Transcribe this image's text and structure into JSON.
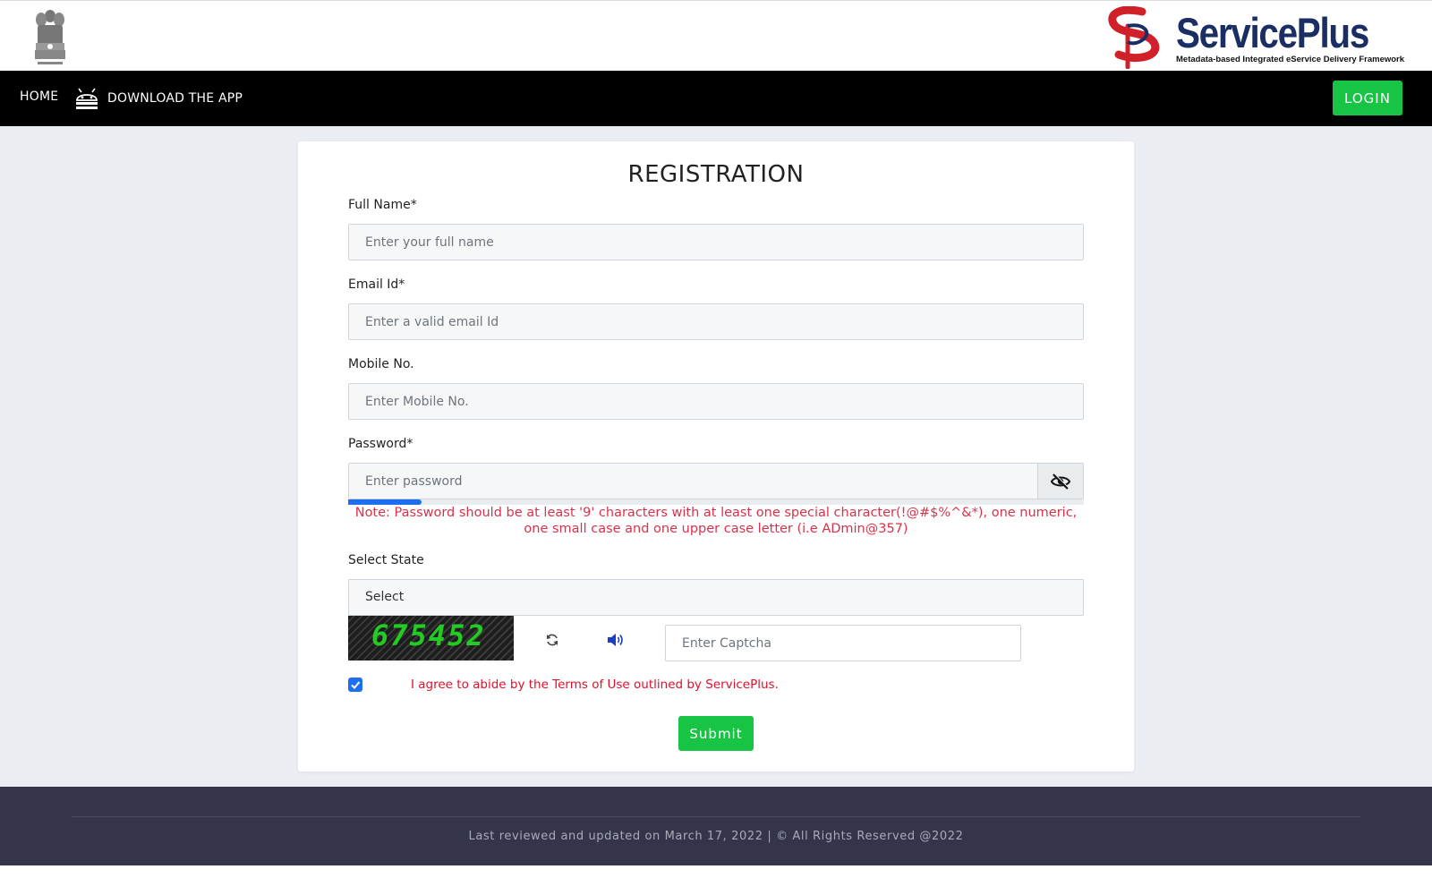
{
  "header": {
    "brand_name": "ServicePlus",
    "brand_tagline": "Metadata-based Integrated eService Delivery Framework"
  },
  "nav": {
    "home": "HOME",
    "download_app": "DOWNLOAD THE APP",
    "login": "LOGIN"
  },
  "form": {
    "title": "REGISTRATION",
    "full_name": {
      "label": "Full Name*",
      "placeholder": "Enter your full name",
      "value": ""
    },
    "email": {
      "label": "Email Id*",
      "placeholder": "Enter a valid email Id",
      "value": ""
    },
    "mobile": {
      "label": "Mobile No.",
      "placeholder": "Enter Mobile No.",
      "value": ""
    },
    "password": {
      "label": "Password*",
      "placeholder": "Enter password",
      "value": "",
      "strength": 0.1,
      "note": "Note: Password should be at least '9' characters with at least one special character(!@#$%^&*), one numeric, one small case and one upper case letter (i.e ADmin@357)"
    },
    "state": {
      "label": "Select State",
      "selected": "Select"
    },
    "captcha": {
      "code": "675452",
      "placeholder": "Enter Captcha",
      "value": ""
    },
    "agree": {
      "checked": true,
      "text": "I agree to abide by the Terms of Use outlined by ServicePlus."
    },
    "submit": "Submit"
  },
  "footer": {
    "text": "Last reviewed and updated on March 17, 2022 | © All Rights Reserved @2022"
  },
  "colors": {
    "primary_green": "#17c444",
    "navbar_bg": "#000000",
    "footer_bg": "#34354b",
    "error_red": "#d8324b",
    "check_blue": "#1e6ff0",
    "brand_blue": "#1a2e63",
    "brand_red": "#d0202a"
  },
  "icons": {
    "emblem": "national-emblem-icon",
    "brand_logo": "serviceplus-logo-icon",
    "android": "android-icon",
    "eye_slash": "eye-slash-icon",
    "refresh": "refresh-icon",
    "audio": "volume-icon",
    "check": "check-icon"
  }
}
